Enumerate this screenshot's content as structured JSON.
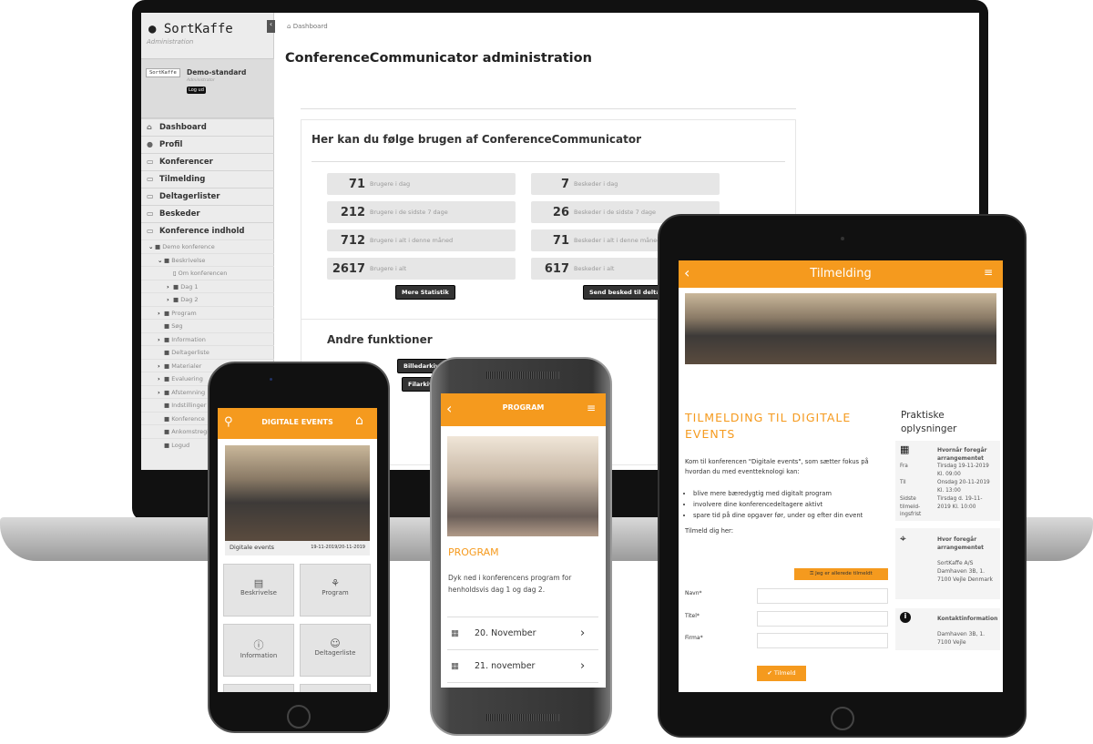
{
  "colors": {
    "accent": "#f59a1e",
    "sidebar": "#ececec"
  },
  "admin": {
    "logo": "SortKaffe",
    "logo_sub": "Administration",
    "collapse_icon": "chevron-left-icon",
    "user": {
      "badge": "SortKaffe",
      "name": "Demo-standard",
      "role": "Administrator",
      "logout": "Log ud"
    },
    "nav": [
      {
        "label": "Dashboard",
        "icon": "home-icon"
      },
      {
        "label": "Profil",
        "icon": "user-icon"
      },
      {
        "label": "Konferencer",
        "icon": "book-icon"
      },
      {
        "label": "Tilmelding",
        "icon": "book-icon"
      },
      {
        "label": "Deltagerlister",
        "icon": "book-icon"
      },
      {
        "label": "Beskeder",
        "icon": "book-icon"
      },
      {
        "label": "Konference indhold",
        "icon": "book-icon"
      }
    ],
    "tree": [
      {
        "label": "Demo konference",
        "level": 1,
        "arrow": "down"
      },
      {
        "label": "Beskrivelse",
        "level": 2,
        "arrow": "down"
      },
      {
        "label": "Om konferencen",
        "level": 3,
        "arrow": "",
        "file": true
      },
      {
        "label": "Dag 1",
        "level": 3,
        "arrow": "right"
      },
      {
        "label": "Dag 2",
        "level": 3,
        "arrow": "right"
      },
      {
        "label": "Program",
        "level": 2,
        "arrow": "right"
      },
      {
        "label": "Søg",
        "level": 2,
        "arrow": ""
      },
      {
        "label": "Information",
        "level": 2,
        "arrow": "right"
      },
      {
        "label": "Deltagerliste",
        "level": 2,
        "arrow": ""
      },
      {
        "label": "Materialer",
        "level": 2,
        "arrow": "right"
      },
      {
        "label": "Evaluering",
        "level": 2,
        "arrow": "right"
      },
      {
        "label": "Afstemning",
        "level": 2,
        "arrow": "right"
      },
      {
        "label": "Indstillinger",
        "level": 2,
        "arrow": ""
      },
      {
        "label": "Konference",
        "level": 2,
        "arrow": ""
      },
      {
        "label": "Ankomstregistrering",
        "level": 2,
        "arrow": ""
      },
      {
        "label": "Logud",
        "level": 2,
        "arrow": ""
      }
    ],
    "breadcrumb": "Dashboard",
    "title": "ConferenceCommunicator administration",
    "panel_title": "Her kan du følge brugen af ConferenceCommunicator",
    "users_stats": [
      {
        "value": "71",
        "label": "Brugere i dag"
      },
      {
        "value": "212",
        "label": "Brugere i de sidste 7 dage"
      },
      {
        "value": "712",
        "label": "Brugere i alt i denne måned"
      },
      {
        "value": "2617",
        "label": "Brugere i alt"
      }
    ],
    "message_stats": [
      {
        "value": "7",
        "label": "Beskeder i dag"
      },
      {
        "value": "26",
        "label": "Beskeder i de sidste 7 dage"
      },
      {
        "value": "71",
        "label": "Beskeder i alt i denne måned"
      },
      {
        "value": "617",
        "label": "Beskeder i alt"
      }
    ],
    "more_stats": "Mere Statistik",
    "send_message": "Send besked til deltagere",
    "other_title": "Andre funktioner",
    "image_archive": "Billedarkiver",
    "file_archive": "Filarkiver"
  },
  "phone1": {
    "title": "DIGITALE EVENTS",
    "event_name": "Digitale events",
    "event_dates": "19-11-2019/20-11-2019",
    "tiles": [
      {
        "label": "Beskrivelse",
        "icon": "document-icon"
      },
      {
        "label": "Program",
        "icon": "book-icon"
      },
      {
        "label": "Information",
        "icon": "info-icon"
      },
      {
        "label": "Deltagerliste",
        "icon": "people-icon"
      }
    ]
  },
  "phone2": {
    "title": "PROGRAM",
    "heading": "PROGRAM",
    "text": "Dyk ned i konferencens program for henholdsvis dag 1 og dag 2.",
    "days": [
      "20. November",
      "21. november"
    ]
  },
  "tablet": {
    "title": "Tilmelding",
    "heading": "TILMELDING TIL DIGITALE EVENTS",
    "intro": "Kom til konferencen \"Digitale events\", som sætter fokus på hvordan du med eventteknologi kan:",
    "bullets": [
      "blive mere bæredygtig med digitalt program",
      "involvere dine konferencedeltagere aktivt",
      "spare tid på dine opgaver før, under og efter din event"
    ],
    "signup_prompt": "Tilmeld dig her:",
    "already": "Jeg er allerede tilmeldt",
    "fields": [
      "Navn*",
      "Titel*",
      "Firma*"
    ],
    "submit": "Tilmeld",
    "side_title": "Praktiske oplysninger",
    "when": {
      "title": "Hvornår foregår arrangementet",
      "rows": [
        {
          "k": "Fra",
          "v": "Tirsdag 19-11-2019 Kl. 09:00"
        },
        {
          "k": "Til",
          "v": "Onsdag 20-11-2019 Kl. 13:00"
        },
        {
          "k": "Sidste tilmeld-ingsfrist",
          "v": "Tirsdag d. 19-11-2019 Kl. 10:00"
        }
      ]
    },
    "where": {
      "title": "Hvor foregår arrangementet",
      "address": "SortKaffe A/S Damhaven 3B, 1. 7100 Vejle Denmark"
    },
    "contact": {
      "title": "Kontaktinformation",
      "address": "Damhaven 3B, 1. 7100 Vejle"
    }
  }
}
